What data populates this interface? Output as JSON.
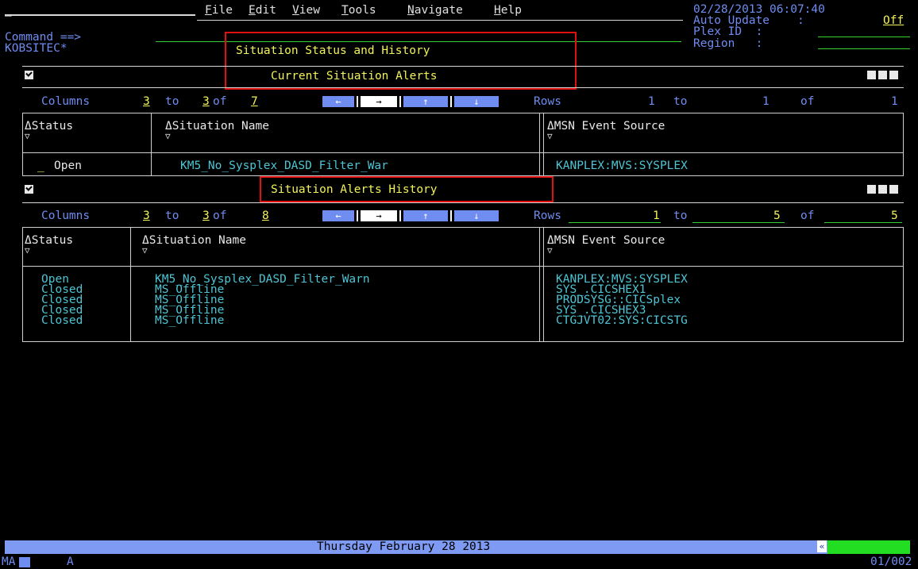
{
  "menu": {
    "items": [
      "File",
      "Edit",
      "View",
      "Tools",
      "Navigate",
      "Help"
    ],
    "mnemonic": [
      "F",
      "E",
      "V",
      "T",
      "N",
      "H"
    ]
  },
  "header": {
    "datetime": "02/28/2013 06:07:40",
    "auto_update_label": "Auto Update    :",
    "auto_update_value": "Off",
    "plex_id_label": "Plex ID  :",
    "region_label": "Region   :",
    "command_label": "Command ==>",
    "workspace": "KOBSITEC*",
    "title": "Situation Status and History"
  },
  "panel_current": {
    "title": "Current Situation Alerts",
    "columns_label": "Columns",
    "col_from": "3",
    "to_label": "to",
    "col_to": "3",
    "of_label": "of",
    "col_total": "7",
    "rows_label": "Rows",
    "row_from": "1",
    "row_to": "1",
    "row_total": "1",
    "headers": [
      "ΔStatus",
      "ΔSituation Name",
      "ΔMSN Event Source"
    ],
    "rows": [
      {
        "select": "_",
        "status": "Open",
        "name": "KM5_No_Sysplex_DASD_Filter_War",
        "source": "KANPLEX:MVS:SYSPLEX"
      }
    ]
  },
  "panel_history": {
    "title": "Situation Alerts History",
    "columns_label": "Columns",
    "col_from": "3",
    "to_label": "to",
    "col_to": "3",
    "of_label": "of",
    "col_total": "8",
    "rows_label": "Rows",
    "row_from": "1",
    "row_to": "5",
    "row_total": "5",
    "headers": [
      "ΔStatus",
      "ΔSituation Name",
      "ΔMSN Event Source"
    ],
    "status_col": "Open\nClosed\nClosed\nClosed\nClosed",
    "name_col": "KM5_No_Sysplex_DASD_Filter_Warn\nMS_Offline\nMS_Offline\nMS_Offline\nMS_Offline",
    "source_col": "KANPLEX:MVS:SYSPLEX\nSYS_.CICSHEX1\nPRODSYSG::CICSplex\nSYS_.CICSHEX3\nCTGJVT02:SYS:CICSTG"
  },
  "arrows": [
    "←",
    "→",
    "↑",
    "↓"
  ],
  "icons": {
    "sort_down": "▽",
    "panel_check": "check-icon",
    "scroll_left": "«"
  },
  "footer": {
    "date": "Thursday February 28 2013",
    "oia_left": "MA",
    "oia_mid": "A",
    "oia_right": "01/002"
  },
  "colors": {
    "accent_blue": "#6f8cf0",
    "highlight_red": "#e01010",
    "field_green": "#33cc33",
    "title_yellow": "#f2f25a"
  }
}
